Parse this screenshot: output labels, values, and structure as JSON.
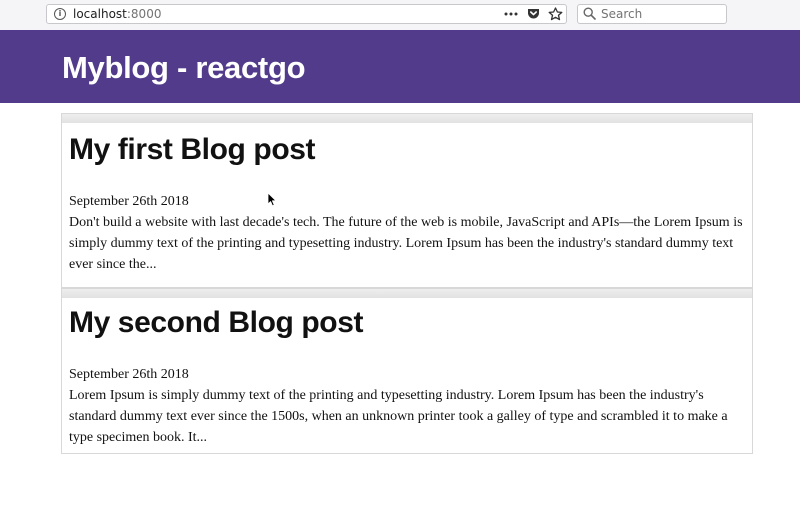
{
  "browser": {
    "url_host": "localhost",
    "url_port": ":8000",
    "search_placeholder": "Search"
  },
  "header": {
    "title": "Myblog - reactgo",
    "background": "#523b8b"
  },
  "posts": [
    {
      "title": "My first Blog post",
      "date": "September 26th 2018",
      "excerpt": "Don't build a website with last decade's tech. The future of the web is mobile, JavaScript and APIs—the Lorem Ipsum is simply dummy text of the printing and typesetting industry. Lorem Ipsum has been the industry's standard dummy text ever since the..."
    },
    {
      "title": "My second Blog post",
      "date": "September 26th 2018",
      "excerpt": "Lorem Ipsum is simply dummy text of the printing and typesetting industry. Lorem Ipsum has been the industry's standard dummy text ever since the 1500s, when an unknown printer took a galley of type and scrambled it to make a type specimen book. It..."
    }
  ]
}
